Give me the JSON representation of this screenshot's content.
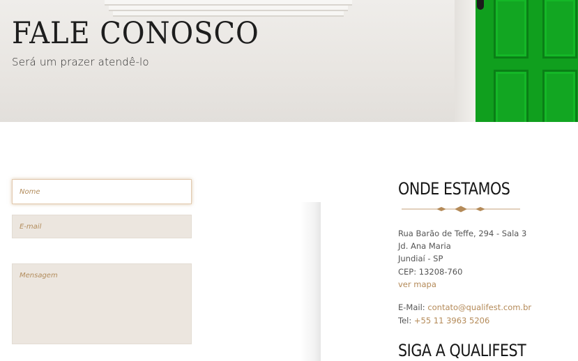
{
  "hero": {
    "title": "FALE CONOSCO",
    "subtitle": "Será um prazer atendê-lo"
  },
  "form": {
    "name_placeholder": "Nome",
    "email_placeholder": "E-mail",
    "message_placeholder": "Mensagem"
  },
  "location": {
    "heading": "ONDE ESTAMOS",
    "address_line1": "Rua Barão de Teffe, 294 - Sala 3",
    "address_line2": "Jd. Ana Maria",
    "address_line3": "Jundiaí - SP",
    "address_line4": "CEP: 13208-760",
    "map_link": "ver mapa"
  },
  "contact": {
    "email_label": "E-Mail:",
    "email_value": "contato@qualifest.com.br",
    "phone_label": "Tel:",
    "phone_value": "+55 11 3963 5206"
  },
  "social": {
    "heading": "SIGA A QUALIFEST"
  },
  "colors": {
    "accent": "#b48a58",
    "door_green": "#109f1e",
    "field_bg": "#ece6df"
  }
}
